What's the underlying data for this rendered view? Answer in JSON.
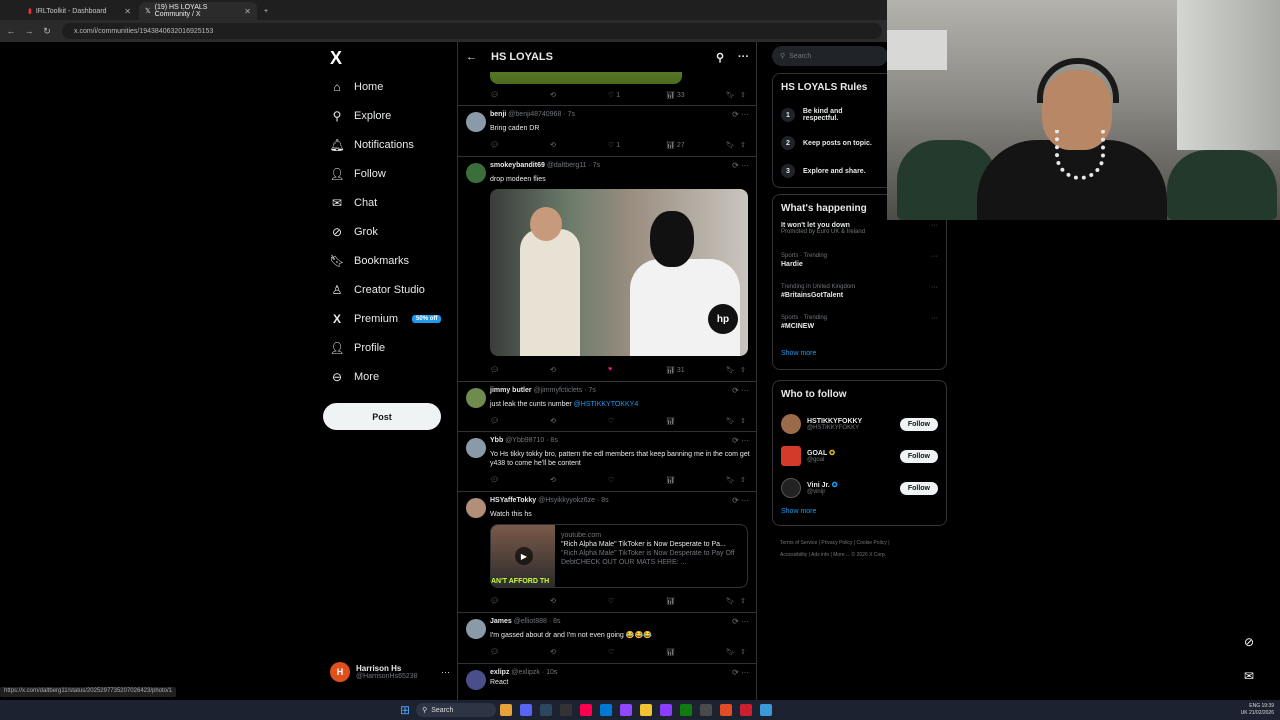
{
  "browser": {
    "tabs": [
      {
        "label": "IRLToolkit - Dashboard"
      },
      {
        "label": "(19) HS LOYALS Community / X"
      }
    ],
    "url": "x.com/i/communities/1943840632016925153",
    "status_url": "https://x.com/daltberg11/status/2025297735207026423/photo/1"
  },
  "nav": {
    "logo": "X",
    "items": [
      {
        "label": "Home"
      },
      {
        "label": "Explore"
      },
      {
        "label": "Notifications"
      },
      {
        "label": "Follow"
      },
      {
        "label": "Chat"
      },
      {
        "label": "Grok"
      },
      {
        "label": "Bookmarks"
      },
      {
        "label": "Creator Studio"
      },
      {
        "label": "Premium",
        "badge": "50% off"
      },
      {
        "label": "Profile"
      },
      {
        "label": "More"
      }
    ],
    "post_label": "Post",
    "user": {
      "name": "Harrison Hs",
      "handle": "@HarrisonHs65238",
      "initial": "H"
    }
  },
  "community": {
    "title": "HS LOYALS"
  },
  "tweets": [
    {
      "stats": {
        "likes": "1",
        "views": "33"
      }
    },
    {
      "name": "benji",
      "handle": "@benji48740968 · 7s",
      "text": "Bring caden DR",
      "stats": {
        "likes": "1",
        "views": "27"
      }
    },
    {
      "name": "smokeybandit69",
      "handle": "@daltberg11 · 7s",
      "text": "drop modeen flies",
      "stats": {
        "likes": "",
        "views": "31"
      }
    },
    {
      "name": "jimmy butler",
      "handle": "@jimmyfcticlets · 7s",
      "text": "just leak the cunts number ",
      "mention": "@HSTIKKYTOKKY4",
      "stats": {
        "likes": "",
        "views": ""
      }
    },
    {
      "name": "Ybb",
      "handle": "@Ybb98710 · 8s",
      "text": "Yo Hs tikky tokky bro, pattern the edl members that keep banning me in the com get y438 to come he'll be content",
      "stats": {
        "likes": "",
        "views": ""
      }
    },
    {
      "name": "HSYaffeTokky",
      "handle": "@Hsyikkyyokz6ze · 8s",
      "text": "Watch this hs",
      "card": {
        "domain": "youtube.com",
        "title": "\"Rich Alpha Male\" TikToker is Now Desperate to Pa...",
        "desc": "\"Rich Alpha Male\" TikToker is Now Desperate to Pay Off DebtCHECK OUT OUR MATS HERE: ...",
        "thumb_text": "AN'T AFFORD TH"
      },
      "stats": {
        "likes": "",
        "views": ""
      }
    },
    {
      "name": "James",
      "handle": "@elliot888 · 8s",
      "text": "I'm gassed about dr and I'm not even going 😂😂😂",
      "stats": {
        "likes": "",
        "views": ""
      }
    },
    {
      "name": "exlipz",
      "handle": "@exlipzk · 10s",
      "text": "React",
      "stats": {}
    }
  ],
  "right": {
    "search_placeholder": "Search",
    "rules": {
      "title": "HS LOYALS Rules",
      "items": [
        {
          "n": "1",
          "label": "Be kind and respectful."
        },
        {
          "n": "2",
          "label": "Keep posts on topic."
        },
        {
          "n": "3",
          "label": "Explore and share."
        }
      ]
    },
    "happening": {
      "title": "What's happening",
      "trends": [
        {
          "cat": "",
          "title": "It won't let you down",
          "sub": "Promoted by Euro UK & Ireland"
        },
        {
          "cat": "Sports · Trending",
          "title": "Hardie"
        },
        {
          "cat": "Trending in United Kingdom",
          "title": "#BritainsGotTalent"
        },
        {
          "cat": "Sports · Trending",
          "title": "#MCINEW"
        }
      ],
      "show_more": "Show more"
    },
    "who": {
      "title": "Who to follow",
      "people": [
        {
          "name": "HSTIKKYFOKKY",
          "handle": "@HSTIKKYFOKKY"
        },
        {
          "name": "GOAL",
          "handle": "@goal"
        },
        {
          "name": "Vini Jr.",
          "handle": "@vinijr"
        }
      ],
      "follow_label": "Follow",
      "show_more": "Show more"
    },
    "footer": [
      "Terms of Service",
      "Privacy Policy",
      "Cookie Policy",
      "Accessibility",
      "Ads info",
      "More ...",
      "© 2026 X Corp."
    ]
  },
  "taskbar": {
    "search": "Search",
    "lang": "ENG",
    "region": "UK",
    "time": "19:39",
    "date": "21/02/2026"
  }
}
